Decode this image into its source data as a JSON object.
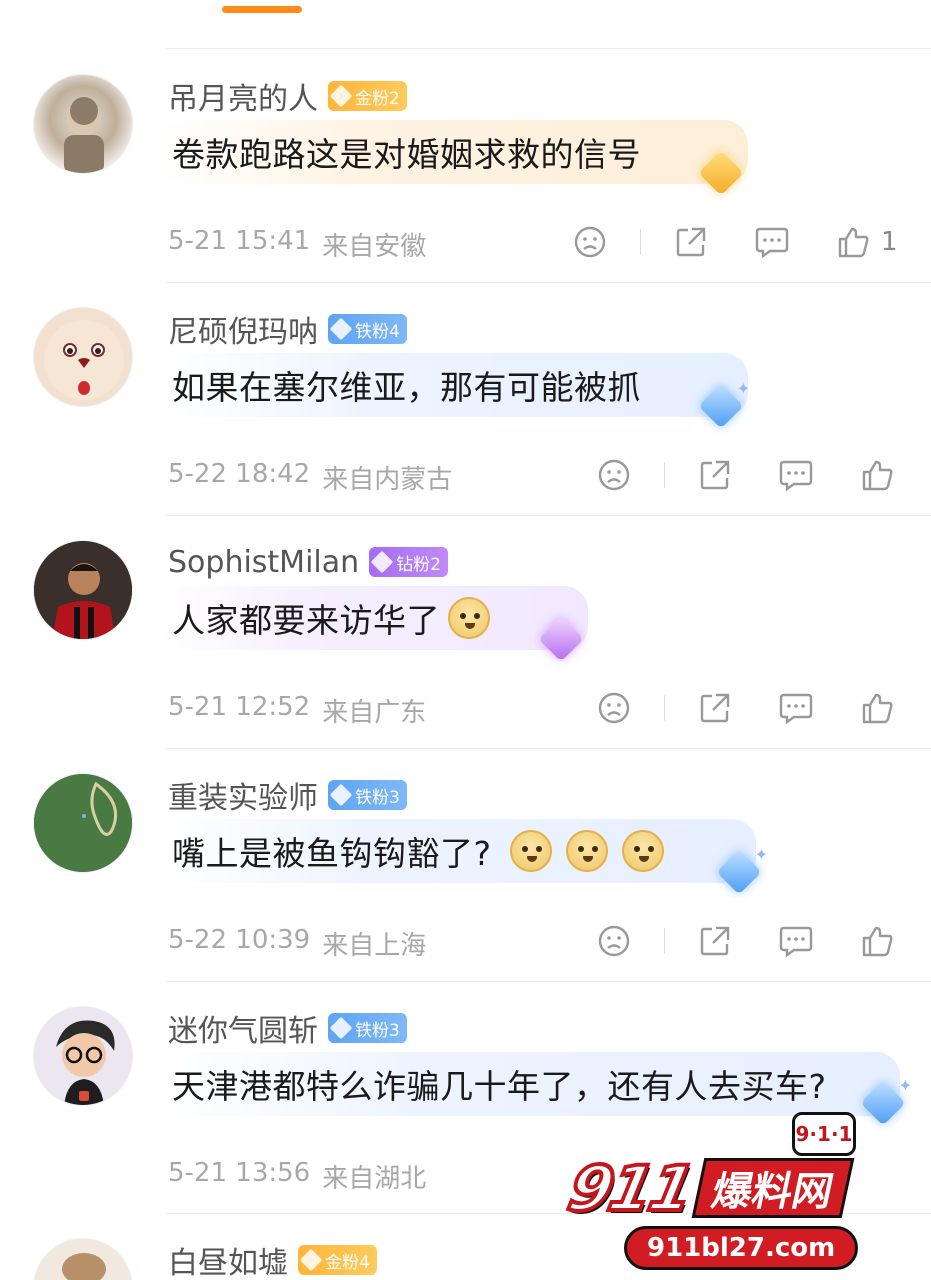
{
  "comments": [
    {
      "username": "吊月亮的人",
      "badge": "金粉2",
      "text": "卷款跑路这是对婚姻求救的信号",
      "date": "5-21 15:41",
      "location": "来自安徽",
      "like_count": "1"
    },
    {
      "username": "尼硕倪玛呐",
      "badge": "铁粉4",
      "text": "如果在塞尔维亚，那有可能被抓",
      "date": "5-22 18:42",
      "location": "来自内蒙古",
      "like_count": ""
    },
    {
      "username": "SophistMilan",
      "badge": "钻粉2",
      "text": "人家都要来访华了",
      "date": "5-21 12:52",
      "location": "来自广东",
      "like_count": ""
    },
    {
      "username": "重装实验师",
      "badge": "铁粉3",
      "text": "嘴上是被鱼钩钩豁了?",
      "date": "5-22 10:39",
      "location": "来自上海",
      "like_count": ""
    },
    {
      "username": "迷你气圆斩",
      "badge": "铁粉3",
      "text": "天津港都特么诈骗几十年了，还有人去买车?",
      "date": "5-21 13:56",
      "location": "来自湖北",
      "like_count": ""
    },
    {
      "username": "白昼如墟",
      "badge": "金粉4"
    }
  ],
  "watermark": {
    "badge": "9·1·1",
    "number": "911",
    "title": "爆料网",
    "url": "911bl27.com"
  },
  "icons": {
    "dislike": "frown-face-icon",
    "share": "share-icon",
    "reply": "comment-icon",
    "like": "thumbs-up-icon"
  },
  "colors": {
    "accent": "#ff8c1a",
    "gold_badge": "#ffb53a",
    "iron_badge": "#5ea4f2",
    "diamond_badge": "#a56df2",
    "meta_text": "#a8a8a8",
    "watermark_red": "#d01c22"
  }
}
